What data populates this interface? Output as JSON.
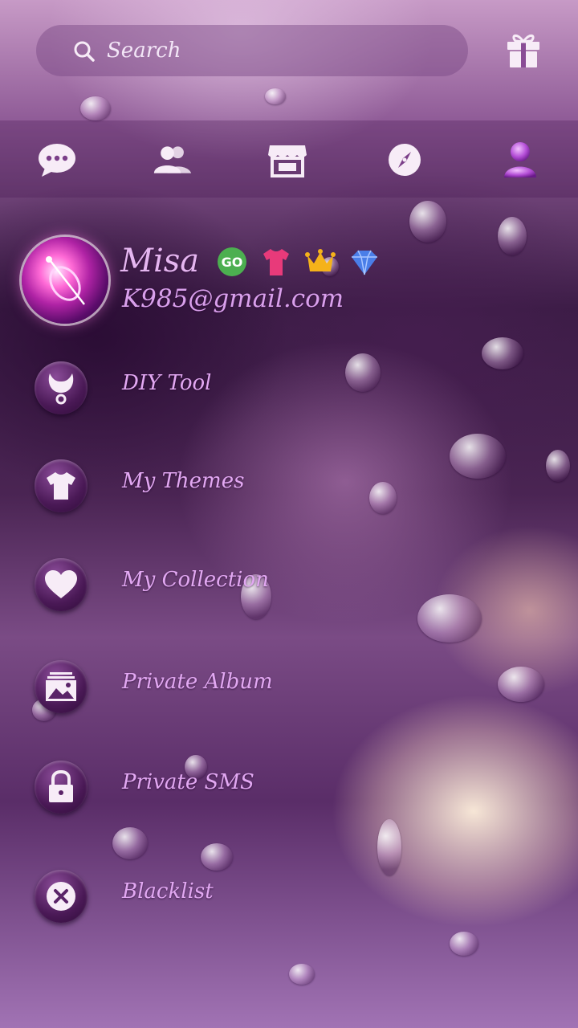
{
  "search": {
    "placeholder": "Search"
  },
  "profile": {
    "name": "Misa",
    "email": "K985@gmail.com"
  },
  "nav": {
    "items": [
      {
        "icon": "chat-bubble-icon"
      },
      {
        "icon": "contacts-icon"
      },
      {
        "icon": "store-icon"
      },
      {
        "icon": "compass-icon"
      },
      {
        "icon": "profile-icon"
      }
    ]
  },
  "badges": [
    {
      "icon": "go-badge-icon",
      "color": "#4caf50"
    },
    {
      "icon": "tshirt-badge-icon",
      "color": "#e83a7a"
    },
    {
      "icon": "crown-badge-icon",
      "color": "#f5b21a"
    },
    {
      "icon": "diamond-badge-icon",
      "color": "#4a7ee8"
    }
  ],
  "menu": {
    "items": [
      {
        "label": "DIY Tool",
        "icon": "diy-tool-icon"
      },
      {
        "label": "My Themes",
        "icon": "tshirt-icon"
      },
      {
        "label": "My Collection",
        "icon": "heart-icon"
      },
      {
        "label": "Private Album",
        "icon": "album-icon"
      },
      {
        "label": "Private SMS",
        "icon": "lock-icon"
      },
      {
        "label": "Blacklist",
        "icon": "block-icon"
      }
    ]
  },
  "colors": {
    "accent": "#e2a8f2",
    "icon_fill": "#f7ecf7"
  }
}
